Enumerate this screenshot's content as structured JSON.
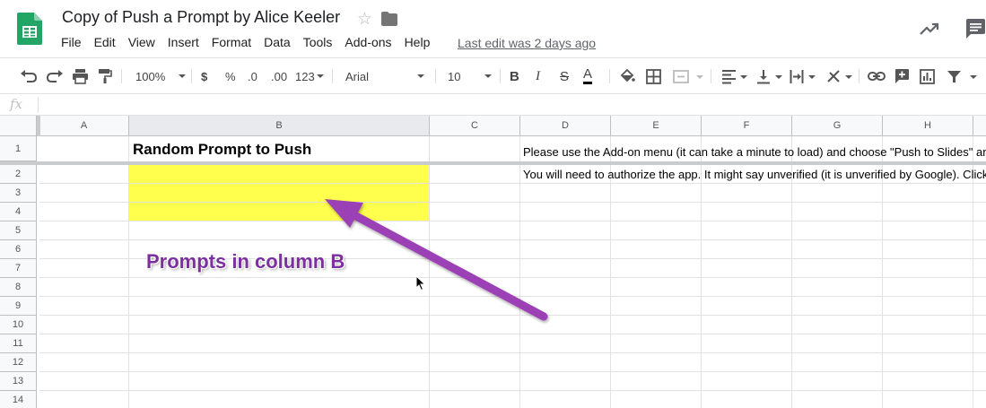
{
  "app": {
    "doc_title": "Copy of Push a Prompt by Alice Keeler",
    "icons": {
      "logo": "sheets-logo-icon",
      "star": "star-icon",
      "folder": "folder-icon",
      "activity": "trending-up-icon",
      "comments": "comment-icon"
    },
    "menu": [
      "File",
      "Edit",
      "View",
      "Insert",
      "Format",
      "Data",
      "Tools",
      "Add-ons",
      "Help"
    ],
    "last_edit": "Last edit was 2 days ago"
  },
  "toolbar": {
    "zoom": "100%",
    "currency": "$",
    "percent": "%",
    "decrease_decimals": ".0",
    "increase_decimals": ".00",
    "more_formats": "123",
    "font": "Arial",
    "font_size": "10",
    "bold": "B",
    "italic": "I",
    "strikethrough": "S",
    "text_color": "A"
  },
  "formula_bar": {
    "fx": "fx",
    "value": ""
  },
  "grid": {
    "columns": [
      "A",
      "B",
      "C",
      "D",
      "E",
      "F",
      "G",
      "H"
    ],
    "rows": [
      "1",
      "2",
      "3",
      "4",
      "5",
      "6",
      "7",
      "8",
      "9",
      "10",
      "11",
      "12",
      "13",
      "14"
    ],
    "cells": {
      "B1": "Random Prompt to Push",
      "D1": "Please use the Add-on menu (it can take a minute to load) and choose \"Push to Slides\" and",
      "D2": "You will need to authorize the app. It might say unverified (it is unverified by Google). Click"
    },
    "highlight_color": "#ffff4d"
  },
  "annotation": {
    "text": "Prompts in column B",
    "color": "#7b2fa0",
    "arrow_color": "#9b3fb5"
  }
}
